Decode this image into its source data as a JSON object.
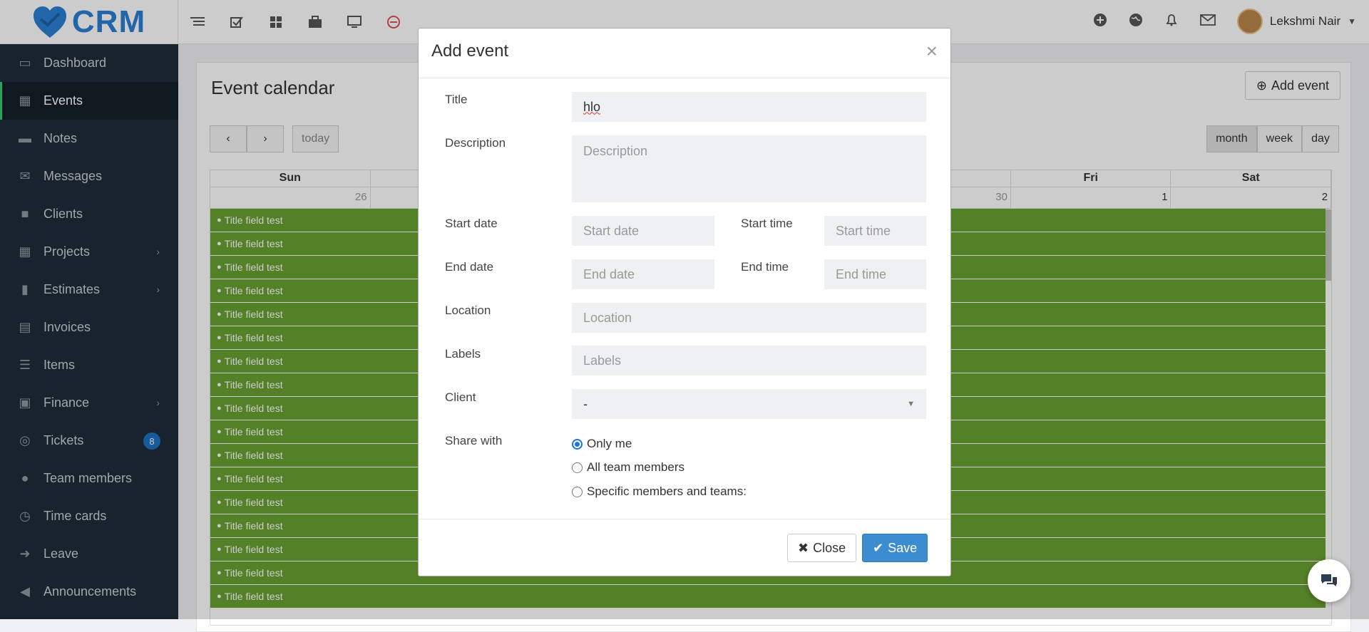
{
  "brand": {
    "name": "CRM"
  },
  "topbar": {
    "icons": [
      "list-icon",
      "checkbox-icon",
      "grid-icon",
      "briefcase-icon",
      "monitor-icon",
      "clock-stop-icon"
    ],
    "right_icons": [
      "plus-circle-icon",
      "globe-icon",
      "bell-icon",
      "envelope-icon"
    ],
    "user_name": "Lekshmi Nair"
  },
  "sidebar": {
    "items": [
      {
        "label": "Dashboard",
        "icon": "monitor-icon"
      },
      {
        "label": "Events",
        "icon": "calendar-icon",
        "active": true
      },
      {
        "label": "Notes",
        "icon": "book-icon"
      },
      {
        "label": "Messages",
        "icon": "envelope-icon"
      },
      {
        "label": "Clients",
        "icon": "briefcase-icon"
      },
      {
        "label": "Projects",
        "icon": "grid-icon",
        "chevron": true
      },
      {
        "label": "Estimates",
        "icon": "file-icon",
        "chevron": true
      },
      {
        "label": "Invoices",
        "icon": "file-text-icon"
      },
      {
        "label": "Items",
        "icon": "list-icon"
      },
      {
        "label": "Finance",
        "icon": "money-icon",
        "chevron": true
      },
      {
        "label": "Tickets",
        "icon": "lifebuoy-icon",
        "badge": "8"
      },
      {
        "label": "Team members",
        "icon": "user-icon"
      },
      {
        "label": "Time cards",
        "icon": "clock-icon"
      },
      {
        "label": "Leave",
        "icon": "sign-out-icon"
      },
      {
        "label": "Announcements",
        "icon": "bullhorn-icon"
      }
    ]
  },
  "calendar": {
    "title": "Event calendar",
    "add_label": "Add event",
    "today_label": "today",
    "views": [
      "month",
      "week",
      "day"
    ],
    "days": [
      "Sun",
      "",
      "",
      "",
      "",
      "Fri",
      "Sat"
    ],
    "dates": [
      "26",
      "",
      "",
      "",
      "30",
      "1",
      "2"
    ],
    "event_label": "Title field test",
    "event_count": 17
  },
  "modal": {
    "title": "Add event",
    "fields": {
      "title_label": "Title",
      "title_value": "hlo",
      "description_label": "Description",
      "description_placeholder": "Description",
      "start_date_label": "Start date",
      "start_date_placeholder": "Start date",
      "start_time_label": "Start time",
      "start_time_placeholder": "Start time",
      "end_date_label": "End date",
      "end_date_placeholder": "End date",
      "end_time_label": "End time",
      "end_time_placeholder": "End time",
      "location_label": "Location",
      "location_placeholder": "Location",
      "labels_label": "Labels",
      "labels_placeholder": "Labels",
      "client_label": "Client",
      "client_value": "-",
      "share_label": "Share with"
    },
    "share_options": [
      "Only me",
      "All team members",
      "Specific members and teams:"
    ],
    "close_label": "Close",
    "save_label": "Save"
  },
  "colors": {
    "accent": "#3c8dd0",
    "event": "#6aa132",
    "sidebar": "#1f2c3a"
  }
}
